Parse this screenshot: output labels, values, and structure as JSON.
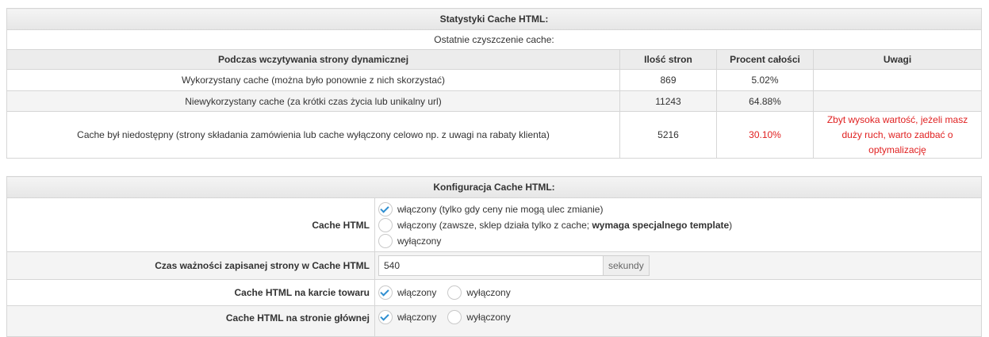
{
  "stats": {
    "title": "Statystyki Cache HTML:",
    "subtitle": "Ostatnie czyszczenie cache:",
    "headers": [
      "Podczas wczytywania strony dynamicznej",
      "Ilość stron",
      "Procent całości",
      "Uwagi"
    ],
    "rows": [
      {
        "label": "Wykorzystany cache (można było ponownie z nich skorzystać)",
        "count": "869",
        "percent": "5.02%",
        "note": ""
      },
      {
        "label": "Niewykorzystany cache (za krótki czas życia lub unikalny url)",
        "count": "11243",
        "percent": "64.88%",
        "note": ""
      },
      {
        "label": "Cache był niedostępny (strony składania zamówienia lub cache wyłączony celowo np. z uwagi na rabaty klienta)",
        "count": "5216",
        "percent": "30.10%",
        "note": "Zbyt wysoka wartość, jeżeli masz duży ruch, warto zadbać o optymalizację"
      }
    ],
    "alert_color": "#e02020"
  },
  "config": {
    "title": "Konfiguracja Cache HTML:",
    "cache_html": {
      "label": "Cache HTML",
      "options": [
        {
          "text": "włączony (tylko gdy ceny nie mogą ulec zmianie)",
          "selected": true
        },
        {
          "text_before": "włączony (zawsze, sklep działa tylko z cache; ",
          "text_bold": "wymaga specjalnego template",
          "text_after": ")",
          "selected": false
        },
        {
          "text": "wyłączony",
          "selected": false
        }
      ]
    },
    "expiry": {
      "label": "Czas ważności zapisanej strony w Cache HTML",
      "value": "540",
      "unit": "sekundy"
    },
    "product_card": {
      "label": "Cache HTML na karcie towaru",
      "on": "włączony",
      "off": "wyłączony",
      "selected": "on"
    },
    "home_page": {
      "label": "Cache HTML na stronie głównej",
      "on": "włączony",
      "off": "wyłączony",
      "selected": "on"
    },
    "check_color": "#2f8fd1"
  }
}
